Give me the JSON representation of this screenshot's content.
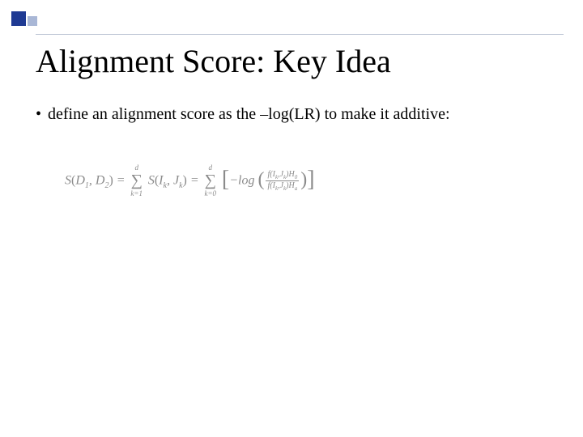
{
  "decor": {
    "present": true
  },
  "title": "Alignment Score: Key Idea",
  "bullet": {
    "mark": "•",
    "text": "define an alignment score as the –log(LR) to make it additive:"
  },
  "formula": {
    "lhs_func": "S",
    "lhs_arg1": "D",
    "lhs_arg1_sub": "1",
    "lhs_arg2": "D",
    "lhs_arg2_sub": "2",
    "eq": " = ",
    "sum1_top": "d",
    "sum1_bot": "k=1",
    "term1_func": "S",
    "term1_arg1": "I",
    "term1_arg1_sub": "k",
    "term1_arg2": "J",
    "term1_arg2_sub": "k",
    "sum2_top": "d",
    "sum2_bot": "k=0",
    "minus": "−",
    "log": "log",
    "frac_num_f": "f",
    "frac_num_arg1": "I",
    "frac_num_arg1_sub": "k",
    "frac_num_arg2": "J",
    "frac_num_arg2_sub": "k",
    "frac_num_hyp": "H",
    "frac_num_hyp_sub": "0",
    "frac_den_f": "f",
    "frac_den_arg1": "I",
    "frac_den_arg1_sub": "k",
    "frac_den_arg2": "J",
    "frac_den_arg2_sub": "k",
    "frac_den_hyp": "H",
    "frac_den_hyp_sub": "a"
  }
}
